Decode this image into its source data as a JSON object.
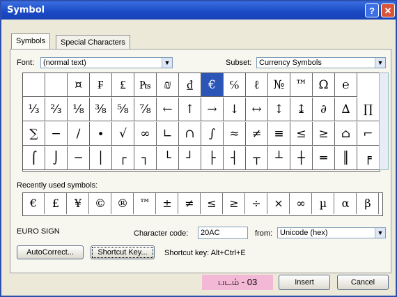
{
  "window": {
    "title": "Symbol",
    "help_label": "?",
    "close_label": "✕"
  },
  "tabs": [
    {
      "label": "Symbols"
    },
    {
      "label": "Special Characters"
    }
  ],
  "font": {
    "label": "Font:",
    "value": "(normal text)"
  },
  "subset": {
    "label": "Subset:",
    "value": "Currency Symbols"
  },
  "symbol_grid": [
    [
      "",
      "",
      "¤",
      "₣",
      "₤",
      "₧",
      "₪",
      "₫",
      "€",
      "℅",
      "ℓ",
      "№",
      "™",
      "Ω",
      "℮"
    ],
    [
      "⅓",
      "⅔",
      "⅛",
      "⅜",
      "⅝",
      "⅞",
      "←",
      "↑",
      "→",
      "↓",
      "↔",
      "↕",
      "↨",
      "∂",
      "∆",
      "∏"
    ],
    [
      "∑",
      "−",
      "∕",
      "∙",
      "√",
      "∞",
      "∟",
      "∩",
      "∫",
      "≈",
      "≠",
      "≡",
      "≤",
      "≥",
      "⌂",
      "⌐"
    ],
    [
      "⌠",
      "⌡",
      "─",
      "│",
      "┌",
      "┐",
      "└",
      "┘",
      "├",
      "┤",
      "┬",
      "┴",
      "┼",
      "═",
      "║",
      "╒"
    ]
  ],
  "selected_symbol": "€",
  "recent": {
    "label": "Recently used symbols:",
    "symbols": [
      "€",
      "£",
      "¥",
      "©",
      "®",
      "™",
      "±",
      "≠",
      "≤",
      "≥",
      "÷",
      "×",
      "∞",
      "µ",
      "α",
      "β"
    ]
  },
  "character_name": "EURO SIGN",
  "character_code": {
    "label": "Character code:",
    "value": "20AC"
  },
  "from": {
    "label": "from:",
    "value": "Unicode (hex)"
  },
  "buttons": {
    "autocorrect": "AutoCorrect...",
    "shortcut_key": "Shortcut Key...",
    "insert": "Insert",
    "cancel": "Cancel"
  },
  "shortcut_key_text": "Shortcut key: Alt+Ctrl+E",
  "caption": "படம் - 03"
}
